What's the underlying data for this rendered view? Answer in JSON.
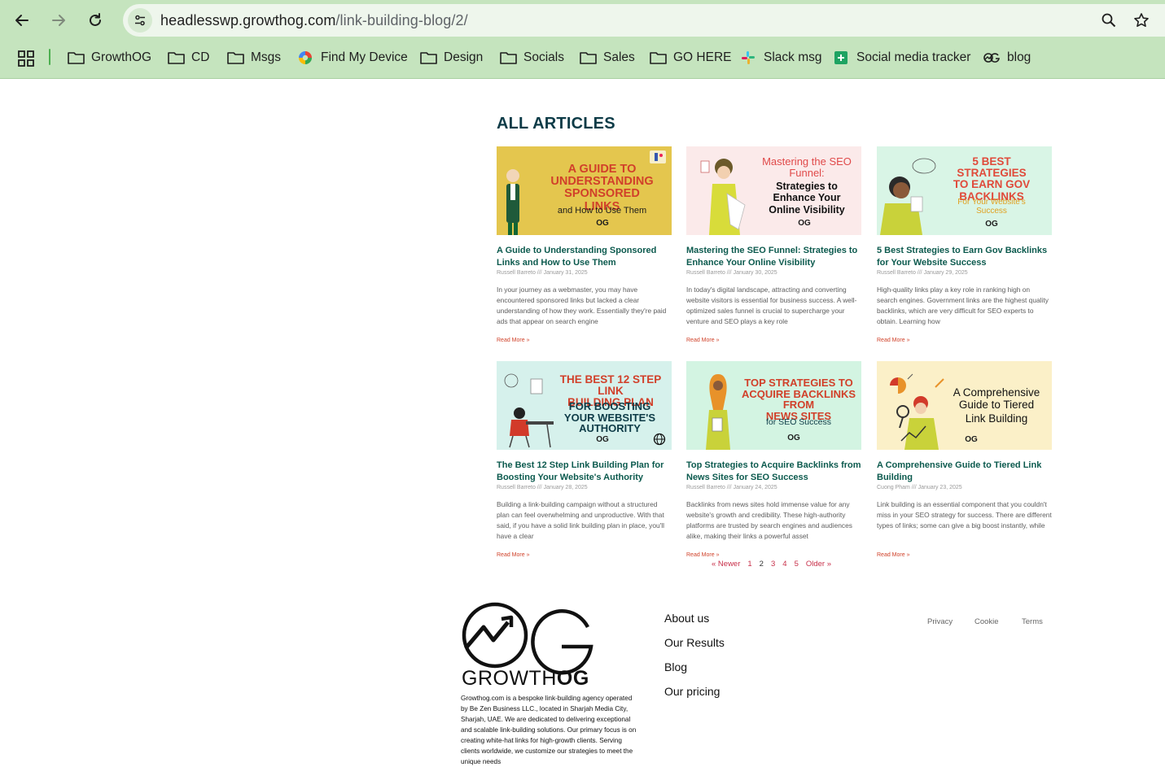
{
  "browser": {
    "url_host": "headlesswp.growthog.com",
    "url_path": "/link-building-blog/2/",
    "bookmarks": [
      {
        "label": "GrowthOG",
        "icon": "folder-icon"
      },
      {
        "label": "CD",
        "icon": "folder-icon"
      },
      {
        "label": "Msgs",
        "icon": "folder-icon"
      },
      {
        "label": "Find My Device",
        "icon": "find-my-device-icon"
      },
      {
        "label": "Design",
        "icon": "folder-icon"
      },
      {
        "label": "Socials",
        "icon": "folder-icon"
      },
      {
        "label": "Sales",
        "icon": "folder-icon"
      },
      {
        "label": "GO HERE",
        "icon": "folder-icon"
      },
      {
        "label": "Slack msg",
        "icon": "slack-icon"
      },
      {
        "label": "Social media tracker",
        "icon": "google-sheets-icon"
      },
      {
        "label": "blog",
        "icon": "growthog-logo-icon"
      }
    ]
  },
  "page": {
    "heading": "ALL ARTICLES",
    "articles": [
      {
        "thumb_lines": [
          "A GUIDE TO",
          "UNDERSTANDING",
          "SPONSORED LINKS"
        ],
        "thumb_sub": "and How to Use Them",
        "title": "A Guide to Understanding Sponsored Links and How to Use Them",
        "meta": "Russell Barreto /// January 31, 2025",
        "excerpt": "In your journey as a webmaster, you may have encountered sponsored links but lacked a clear understanding of how they work. Essentially they're paid ads that appear on search engine",
        "more": "Read More »"
      },
      {
        "thumb_lines": [
          "Mastering the SEO",
          "Funnel:"
        ],
        "thumb_sub": "Strategies to Enhance Your Online Visibility",
        "title": "Mastering the SEO Funnel: Strategies to Enhance Your Online Visibility",
        "meta": "Russell Barreto /// January 30, 2025",
        "excerpt": "In today's digital landscape, attracting and converting website visitors is essential for business success. A well-optimized sales funnel is crucial to supercharge your venture and SEO plays a key role",
        "more": "Read More »"
      },
      {
        "thumb_lines": [
          "5 BEST STRATEGIES",
          "TO EARN GOV",
          "BACKLINKS"
        ],
        "thumb_sub": "For Your Website's Success",
        "title": "5 Best Strategies to Earn Gov Backlinks for Your Website Success",
        "meta": "Russell Barreto /// January 29, 2025",
        "excerpt": "High-quality links play a key role in ranking high on search engines. Government links are the highest quality backlinks, which are very difficult for SEO experts to obtain. Learning how",
        "more": "Read More »"
      },
      {
        "thumb_lines": [
          "THE BEST 12 STEP LINK",
          "BUILDING PLAN"
        ],
        "thumb_sub": "FOR BOOSTING YOUR WEBSITE'S AUTHORITY",
        "title": "The Best 12 Step Link Building Plan for Boosting Your Website's Authority",
        "meta": "Russell Barreto /// January 28, 2025",
        "excerpt": "Building a link-building campaign without a structured plan can feel overwhelming and unproductive. With that said, if you have a solid link building plan in place, you'll have a clear",
        "more": "Read More »"
      },
      {
        "thumb_lines": [
          "TOP STRATEGIES TO",
          "ACQUIRE BACKLINKS FROM",
          "NEWS SITES"
        ],
        "thumb_sub": "for SEO Success",
        "title": "Top Strategies to Acquire Backlinks from News Sites for SEO Success",
        "meta": "Russell Barreto /// January 24, 2025",
        "excerpt": "Backlinks from news sites hold immense value for any website's growth and credibility. These high-authority platforms are trusted by search engines and audiences alike, making their links a powerful asset",
        "more": "Read More »"
      },
      {
        "thumb_lines": [
          "A Comprehensive",
          "Guide to Tiered"
        ],
        "thumb_sub": "Link Building",
        "title": "A Comprehensive Guide to Tiered Link Building",
        "meta": "Cuong Pham /// January 23, 2025",
        "excerpt": "Link building is an essential component that you couldn't miss in your SEO strategy for success. There are different types of links; some can give a big boost instantly, while",
        "more": "Read More »"
      }
    ],
    "thumb_brand": "OG",
    "pagination": {
      "newer": "« Newer",
      "pages": [
        "1",
        "2",
        "3",
        "4",
        "5"
      ],
      "current": "2",
      "older": "Older »"
    }
  },
  "footer": {
    "logo_prefix": "GROWTH",
    "logo_suffix": "OG",
    "about": "Growthog.com is a bespoke link-building agency operated by Be Zen Business LLC., located in Sharjah Media City, Sharjah, UAE. We are dedicated to delivering exceptional and scalable link-building solutions. Our primary focus is on creating white-hat links for high-growth clients. Serving clients worldwide, we customize our strategies to meet the unique needs",
    "nav": [
      "About us",
      "Our Results",
      "Blog",
      "Our pricing"
    ],
    "legal": [
      "Privacy",
      "Cookie",
      "Terms"
    ]
  },
  "colors": {
    "chrome": "#c5e4be",
    "heading": "#0d3b47",
    "card_title": "#0c5a4e",
    "read_more": "#d0422a",
    "pager": "#c8304a"
  }
}
